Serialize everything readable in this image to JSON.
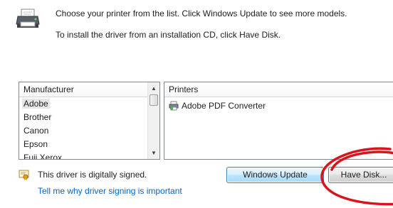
{
  "header": {
    "line1": "Choose your printer from the list. Click Windows Update to see more models.",
    "line2": "To install the driver from an installation CD, click Have Disk."
  },
  "manufacturer_list": {
    "header": "Manufacturer",
    "items": [
      "Adobe",
      "Brother",
      "Canon",
      "Epson",
      "Fuji Xerox"
    ],
    "selected": "Adobe"
  },
  "printers_list": {
    "header": "Printers",
    "items": [
      "Adobe PDF Converter"
    ]
  },
  "footer": {
    "signed_text": "This driver is digitally signed.",
    "signing_link": "Tell me why driver signing is important"
  },
  "buttons": {
    "windows_update": "Windows Update",
    "have_disk": "Have Disk..."
  },
  "colors": {
    "annotation": "#d9141b",
    "link": "#0066cc"
  },
  "icons": {
    "header": "printer-icon",
    "printer_item": "printer-small-icon",
    "signed": "certificate-icon"
  }
}
